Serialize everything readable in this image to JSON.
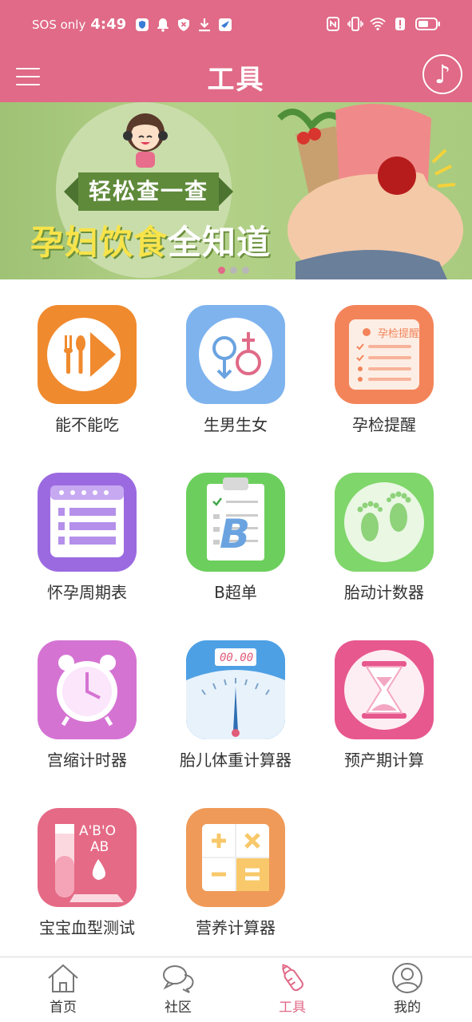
{
  "status_bar": {
    "carrier": "SOS only",
    "time": "4:49"
  },
  "app_bar": {
    "title": "工具",
    "music_glyph": "♪"
  },
  "banner": {
    "tag": "轻松查一查",
    "headline_part1": "孕妇饮食",
    "headline_part2": "全知道",
    "page_count": 3,
    "active_page": 1
  },
  "tools": [
    {
      "label": "能不能吃",
      "icon": "fork-spoon-play-icon"
    },
    {
      "label": "生男生女",
      "icon": "gender-symbols-icon"
    },
    {
      "label": "孕检提醒",
      "icon": "checklist-icon",
      "icon_text": "孕检提醒"
    },
    {
      "label": "怀孕周期表",
      "icon": "calendar-table-icon"
    },
    {
      "label": "B超单",
      "icon": "clipboard-b-icon",
      "icon_text": "B"
    },
    {
      "label": "胎动计数器",
      "icon": "footprints-icon"
    },
    {
      "label": "宫缩计时器",
      "icon": "alarm-clock-icon"
    },
    {
      "label": "胎儿体重计算器",
      "icon": "weight-scale-icon",
      "icon_text": "00.00"
    },
    {
      "label": "预产期计算",
      "icon": "hourglass-icon"
    },
    {
      "label": "宝宝血型测试",
      "icon": "blood-test-tube-icon",
      "icon_text_1": "A'B'O",
      "icon_text_2": "AB"
    },
    {
      "label": "营养计算器",
      "icon": "calculator-icon"
    }
  ],
  "bottom_nav": [
    {
      "label": "首页",
      "icon": "home-icon",
      "active": false
    },
    {
      "label": "社区",
      "icon": "chat-bubbles-icon",
      "active": false
    },
    {
      "label": "工具",
      "icon": "baby-bottle-icon",
      "active": true
    },
    {
      "label": "我的",
      "icon": "user-icon",
      "active": false
    }
  ],
  "colors": {
    "accent": "#e06a87",
    "banner_green": "#a9cb7f"
  }
}
